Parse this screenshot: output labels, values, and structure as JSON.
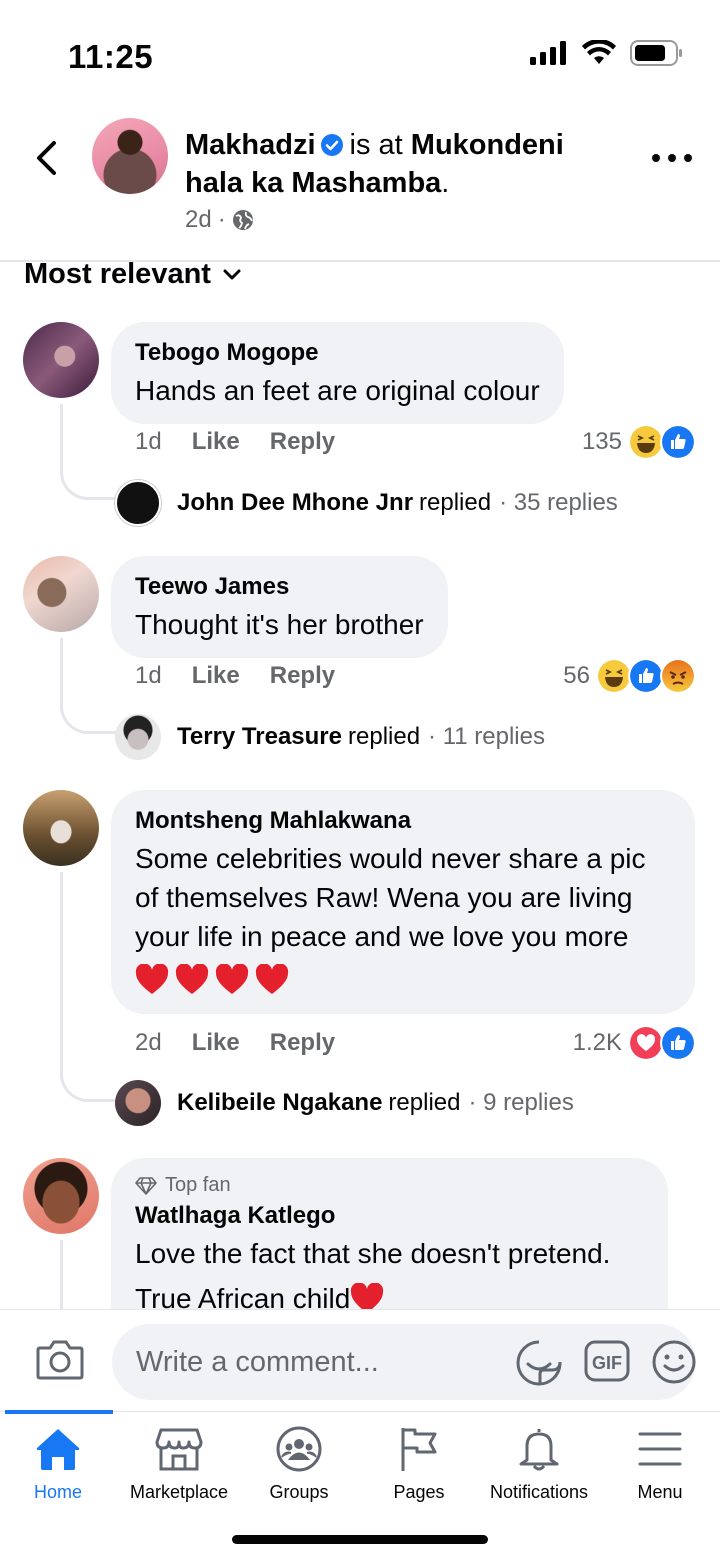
{
  "status_bar": {
    "time": "11:25"
  },
  "post": {
    "author": "Makhadzi",
    "connector": "is at",
    "place": "Mukondeni hala ka Mashamba",
    "period": ".",
    "age": "2d",
    "privacy_icon": "globe-icon"
  },
  "sort": {
    "label": "Most relevant"
  },
  "comments": [
    {
      "name": "Tebogo Mogope",
      "text": "Hands an feet are original colour",
      "age": "1d",
      "like": "Like",
      "reply": "Reply",
      "reaction_count": "135",
      "reaction_icons": [
        "haha",
        "like"
      ],
      "replier": "John Dee Mhone Jnr",
      "replied_word": "replied",
      "replies": "· 35 replies"
    },
    {
      "name": "Teewo James",
      "text": "Thought it's her brother",
      "age": "1d",
      "like": "Like",
      "reply": "Reply",
      "reaction_count": "56",
      "reaction_icons": [
        "haha",
        "like",
        "angry"
      ],
      "replier": "Terry Treasure",
      "replied_word": "replied",
      "replies": "· 11 replies"
    },
    {
      "name": "Montsheng Mahlakwana",
      "text": "Some celebrities would never share a pic of themselves Raw! Wena you are living your life in peace and we love you more",
      "age": "2d",
      "like": "Like",
      "reply": "Reply",
      "reaction_count": "1.2K",
      "reaction_icons": [
        "love",
        "like"
      ],
      "replier": "Kelibeile Ngakane",
      "replied_word": "replied",
      "replies": "· 9 replies"
    },
    {
      "badge": "Top fan",
      "name": "Watlhaga Katlego",
      "text": "Love the fact that she doesn't pretend.",
      "text2": "True African child"
    }
  ],
  "composer": {
    "placeholder": "Write a comment..."
  },
  "tabs": [
    {
      "label": "Home",
      "icon": "home-icon",
      "active": true
    },
    {
      "label": "Marketplace",
      "icon": "marketplace-icon"
    },
    {
      "label": "Groups",
      "icon": "groups-icon"
    },
    {
      "label": "Pages",
      "icon": "pages-flag-icon"
    },
    {
      "label": "Notifications",
      "icon": "bell-icon"
    },
    {
      "label": "Menu",
      "icon": "menu-icon"
    }
  ],
  "colors": {
    "accent": "#1877f2",
    "bubble": "#f0f2f5",
    "secondary_text": "#65676b"
  }
}
